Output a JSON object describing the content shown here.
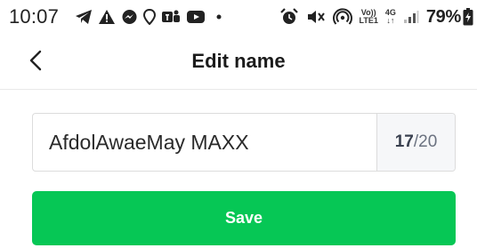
{
  "status_bar": {
    "time": "10:07",
    "network_label_top": "Vo))",
    "network_label_bottom": "LTE1",
    "network_gen": "4G",
    "battery_percent": "79%",
    "left_icons": [
      "telegram-icon",
      "alert-icon",
      "messenger-icon",
      "maps-icon",
      "teams-icon",
      "youtube-icon",
      "dot-icon"
    ],
    "right_icons": [
      "alarm-icon",
      "mute-icon",
      "hotspot-icon",
      "signal-icon",
      "battery-icon"
    ]
  },
  "header": {
    "title": "Edit name",
    "back_icon": "chevron-left-icon"
  },
  "form": {
    "name_value": "AfdolAwaeMay MAXX",
    "char_count_current": "17",
    "char_count_max": "/20"
  },
  "actions": {
    "save_label": "Save"
  },
  "colors": {
    "accent": "#06c755",
    "counter_bg": "#f6f7f9",
    "border": "#dcdcdc"
  }
}
